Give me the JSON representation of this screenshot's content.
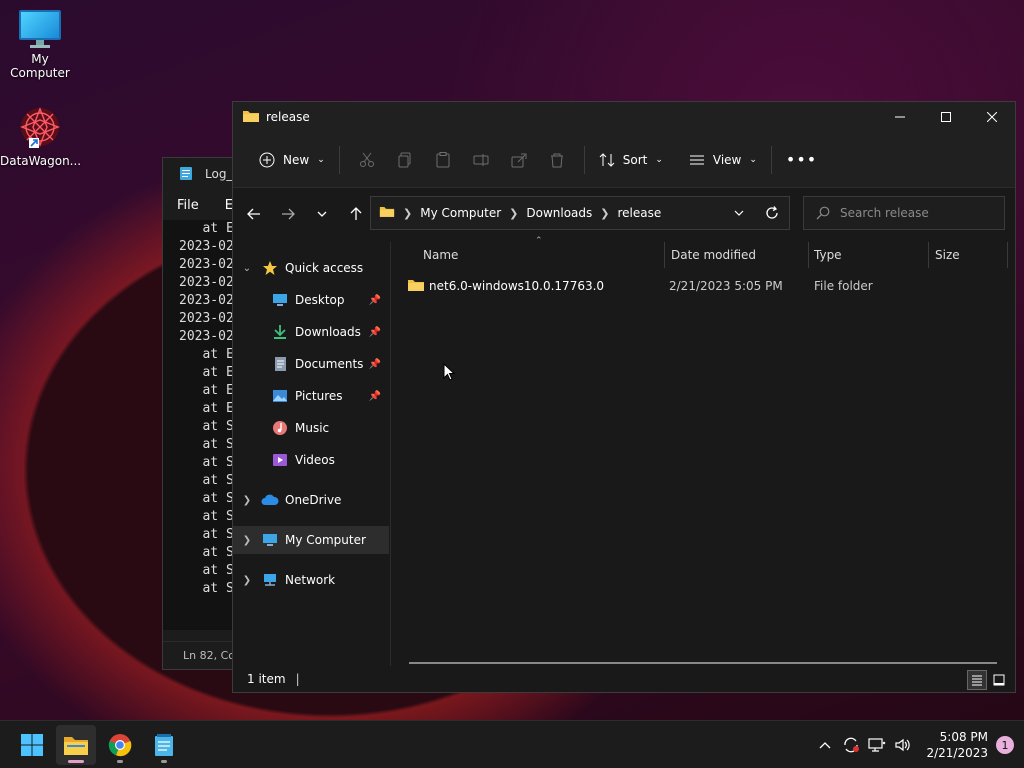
{
  "desktop": {
    "icons": [
      {
        "label": "My Computer"
      },
      {
        "label": "DataWagon..."
      }
    ]
  },
  "notepad": {
    "title": "Log_",
    "menu": [
      "File",
      "E"
    ],
    "lines": [
      "   at E",
      "2023-02",
      "2023-02",
      "2023-02",
      "2023-02",
      "2023-02",
      "2023-02",
      "   at E",
      "   at E",
      "   at E",
      "   at E",
      "   at S",
      "   at S",
      "   at S",
      "   at S",
      "   at S",
      "   at S",
      "   at S",
      "   at S",
      "   at S",
      "   at S"
    ],
    "status": "Ln 82, Co"
  },
  "explorer": {
    "title": "release",
    "toolbar": {
      "new_label": "New",
      "sort_label": "Sort",
      "view_label": "View"
    },
    "address": {
      "crumbs": [
        "My Computer",
        "Downloads",
        "release"
      ]
    },
    "search": {
      "placeholder": "Search release"
    },
    "sidebar": {
      "items": [
        {
          "label": "Quick access"
        },
        {
          "label": "Desktop"
        },
        {
          "label": "Downloads"
        },
        {
          "label": "Documents"
        },
        {
          "label": "Pictures"
        },
        {
          "label": "Music"
        },
        {
          "label": "Videos"
        },
        {
          "label": "OneDrive"
        },
        {
          "label": "My Computer"
        },
        {
          "label": "Network"
        }
      ]
    },
    "columns": {
      "name": "Name",
      "date": "Date modified",
      "type": "Type",
      "size": "Size"
    },
    "rows": [
      {
        "name": "net6.0-windows10.0.17763.0",
        "date": "2/21/2023 5:05 PM",
        "type": "File folder",
        "size": ""
      }
    ],
    "status": {
      "count": "1 item"
    }
  },
  "taskbar": {
    "time": "5:08 PM",
    "date": "2/21/2023",
    "notifications": "1"
  },
  "colors": {
    "accent": "#60cdff",
    "folder": "#f0c043",
    "selected": "#2d2d2d"
  }
}
